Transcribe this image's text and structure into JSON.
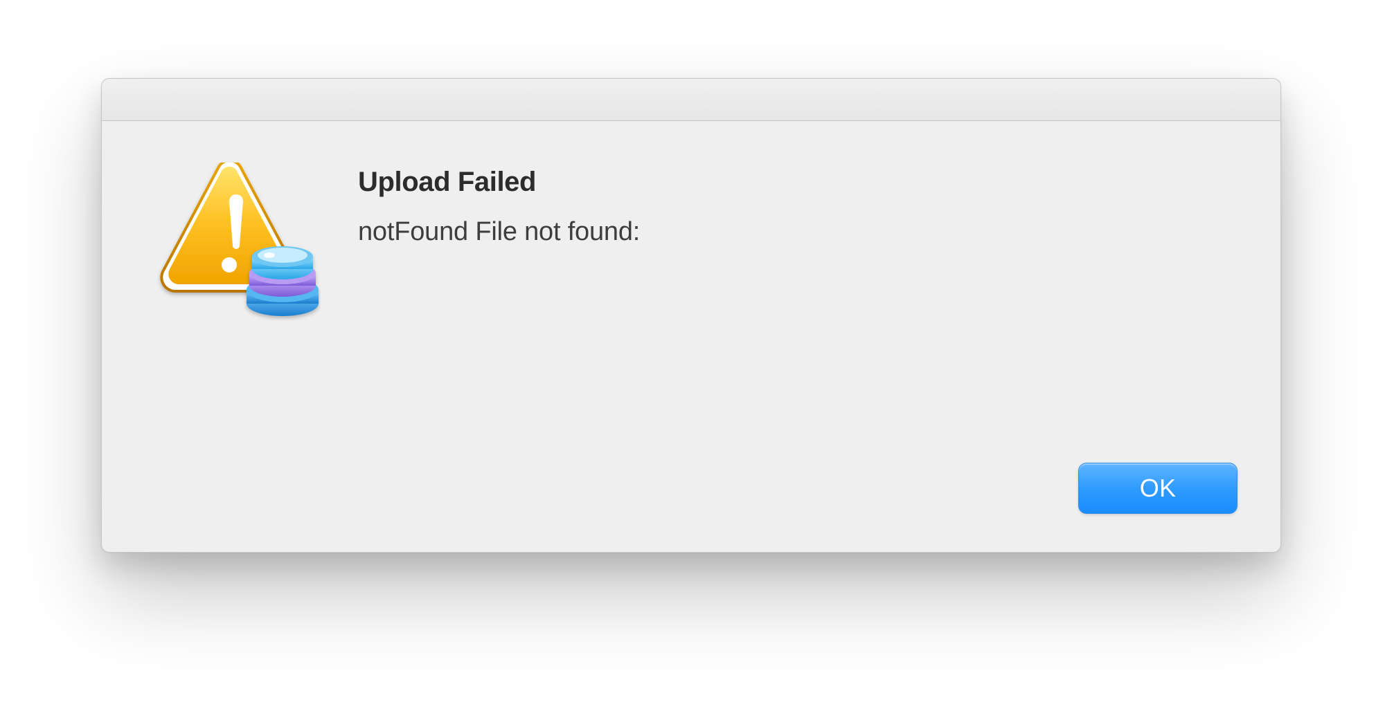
{
  "dialog": {
    "title": "Upload Failed",
    "message": "notFound File not found:",
    "ok_label": "OK"
  },
  "icons": {
    "alert": "warning-triangle-icon",
    "badge": "database-stack-icon"
  },
  "colors": {
    "default_button": "#2f9bff",
    "warning_fill": "#f5b500"
  }
}
